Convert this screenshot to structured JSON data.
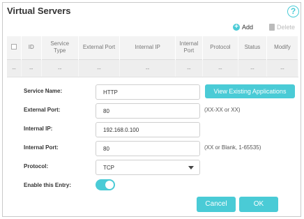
{
  "header": {
    "title": "Virtual Servers",
    "help_glyph": "?"
  },
  "toolbar": {
    "add_label": "Add",
    "delete_label": "Delete",
    "add_glyph": "+"
  },
  "table": {
    "columns": [
      "",
      "ID",
      "Service\nType",
      "External Port",
      "Internal IP",
      "Internal\nPort",
      "Protocol",
      "Status",
      "Modify"
    ],
    "row": [
      "",
      "--",
      "--",
      "--",
      "--",
      "--",
      "--",
      "--",
      "--"
    ]
  },
  "form": {
    "service_name": {
      "label": "Service Name:",
      "value": "HTTP"
    },
    "view_apps_label": "View Existing Applications",
    "external_port": {
      "label": "External Port:",
      "value": "80",
      "hint": "(XX-XX or XX)"
    },
    "internal_ip": {
      "label": "Internal IP:",
      "value": "192.168.0.100"
    },
    "internal_port": {
      "label": "Internal Port:",
      "value": "80",
      "hint": "(XX or Blank, 1-65535)"
    },
    "protocol": {
      "label": "Protocol:",
      "value": "TCP"
    },
    "enable": {
      "label": "Enable this Entry:",
      "on": true
    },
    "cancel_label": "Cancel",
    "ok_label": "OK"
  },
  "colors": {
    "accent": "#4acbd6",
    "header_bg": "#f3f3f3",
    "row_bg": "#eeeeee"
  },
  "icons": {
    "help": "help-icon",
    "add": "add-icon",
    "delete": "trash-icon",
    "dropdown": "chevron-down-icon"
  }
}
